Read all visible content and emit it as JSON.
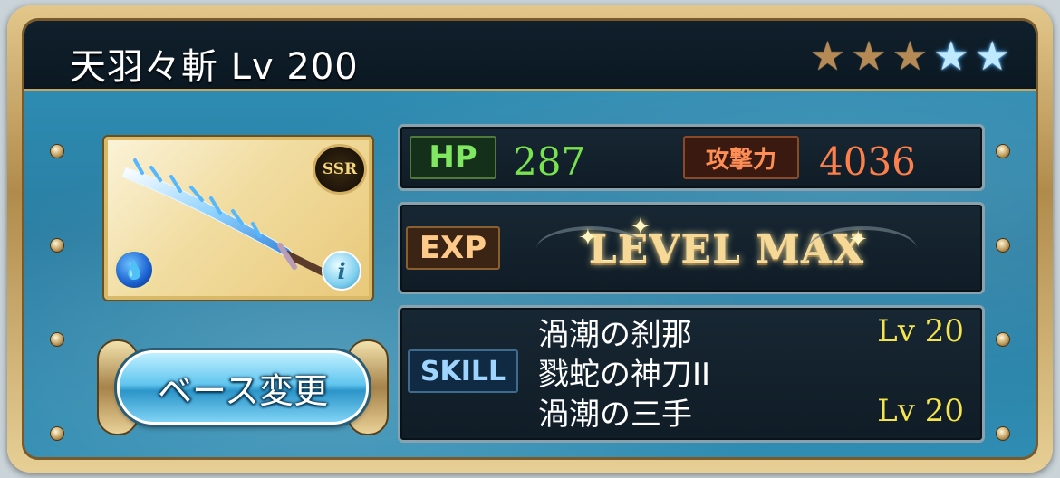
{
  "weapon": {
    "title": "天羽々斬 Lv 200",
    "stars": [
      "gold",
      "gold",
      "gold",
      "blue",
      "blue"
    ],
    "rarity_badge": "SSR",
    "element_icon": "water-drops-icon",
    "info_label": "i"
  },
  "stats": {
    "hp_label": "HP",
    "hp_value": "287",
    "atk_label": "攻撃力",
    "atk_value": "4036",
    "exp_label": "EXP",
    "exp_status": "LEVEL MAX"
  },
  "skills": {
    "label": "SKILL",
    "items": [
      {
        "name": "渦潮の刹那",
        "level": "Lv 20"
      },
      {
        "name": "戮蛇の神刀II",
        "level": ""
      },
      {
        "name": "渦潮の三手",
        "level": "Lv 20"
      }
    ]
  },
  "actions": {
    "base_change": "ベース変更"
  },
  "colors": {
    "panel_blue": "#2f91b8",
    "gold_frame": "#d9b868",
    "hp_green": "#79e34e",
    "atk_orange": "#ff7f4a",
    "skill_level_yellow": "#f5e44a"
  }
}
